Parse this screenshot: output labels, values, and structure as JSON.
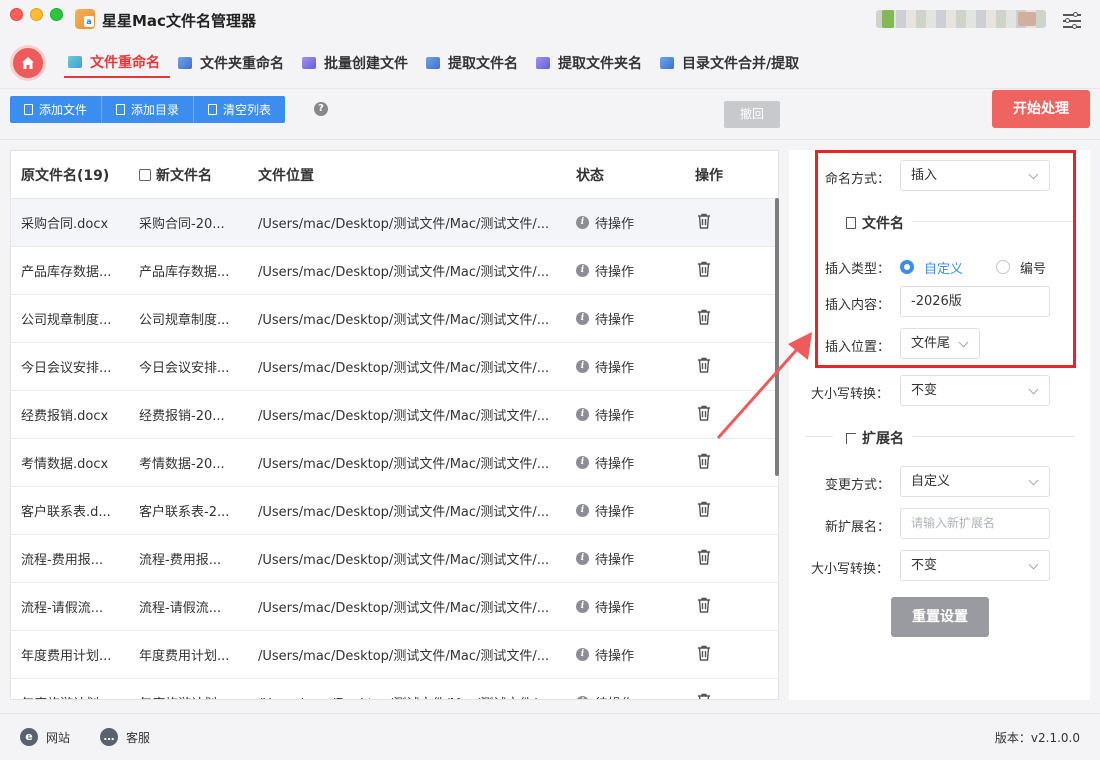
{
  "app": {
    "title": "星星Mac文件名管理器",
    "logo_letter": "a"
  },
  "tabs": [
    {
      "label": "文件重命名",
      "active": true
    },
    {
      "label": "文件夹重命名"
    },
    {
      "label": "批量创建文件"
    },
    {
      "label": "提取文件名"
    },
    {
      "label": "提取文件夹名"
    },
    {
      "label": "目录文件合并/提取"
    }
  ],
  "toolbar": {
    "add_file": "添加文件",
    "add_dir": "添加目录",
    "clear_list": "清空列表",
    "help": "?",
    "undo": "撤回",
    "start": "开始处理"
  },
  "table": {
    "headers": {
      "orig": "原文件名(19)",
      "new": "新文件名",
      "path": "文件位置",
      "status": "状态",
      "action": "操作"
    },
    "rows": [
      {
        "orig": "采购合同.docx",
        "new": "采购合同-20...",
        "path": "/Users/mac/Desktop/测试文件/Mac/测试文件/...",
        "status": "待操作"
      },
      {
        "orig": "产品库存数据...",
        "new": "产品库存数据...",
        "path": "/Users/mac/Desktop/测试文件/Mac/测试文件/...",
        "status": "待操作"
      },
      {
        "orig": "公司规章制度...",
        "new": "公司规章制度...",
        "path": "/Users/mac/Desktop/测试文件/Mac/测试文件/...",
        "status": "待操作"
      },
      {
        "orig": "今日会议安排...",
        "new": "今日会议安排...",
        "path": "/Users/mac/Desktop/测试文件/Mac/测试文件/...",
        "status": "待操作"
      },
      {
        "orig": "经费报销.docx",
        "new": "经费报销-20...",
        "path": "/Users/mac/Desktop/测试文件/Mac/测试文件/...",
        "status": "待操作"
      },
      {
        "orig": "考情数据.docx",
        "new": "考情数据-20...",
        "path": "/Users/mac/Desktop/测试文件/Mac/测试文件/...",
        "status": "待操作"
      },
      {
        "orig": "客户联系表.d...",
        "new": "客户联系表-2...",
        "path": "/Users/mac/Desktop/测试文件/Mac/测试文件/...",
        "status": "待操作"
      },
      {
        "orig": "流程-费用报...",
        "new": "流程-费用报...",
        "path": "/Users/mac/Desktop/测试文件/Mac/测试文件/...",
        "status": "待操作"
      },
      {
        "orig": "流程-请假流...",
        "new": "流程-请假流...",
        "path": "/Users/mac/Desktop/测试文件/Mac/测试文件/...",
        "status": "待操作"
      },
      {
        "orig": "年度费用计划...",
        "new": "年度费用计划...",
        "path": "/Users/mac/Desktop/测试文件/Mac/测试文件/...",
        "status": "待操作"
      },
      {
        "orig": "年度旅游计划...",
        "new": "年度旅游计划...",
        "path": "/Users/mac/Desktop/测试文件/Mac/测试文件/...",
        "status": "待操作"
      }
    ]
  },
  "settings": {
    "naming_mode_label": "命名方式：",
    "naming_mode_value": "插入",
    "filename_section": "文件名",
    "insert_type_label": "插入类型：",
    "insert_type_custom": "自定义",
    "insert_type_number": "编号",
    "insert_content_label": "插入内容：",
    "insert_content_value": "-2026版",
    "insert_pos_label": "插入位置：",
    "insert_pos_value": "文件尾",
    "case_label": "大小写转换：",
    "case_value": "不变",
    "ext_section": "扩展名",
    "change_mode_label": "变更方式：",
    "change_mode_value": "自定义",
    "new_ext_label": "新扩展名：",
    "new_ext_placeholder": "请输入新扩展名",
    "ext_case_label": "大小写转换：",
    "ext_case_value": "不变",
    "reset": "重置设置"
  },
  "footer": {
    "website": "网站",
    "support": "客服",
    "version": "版本：v2.1.0.0"
  },
  "colors": {
    "accent_red": "#e4393c",
    "primary_blue": "#3b8ef0",
    "start_red": "#ef6461",
    "highlight_box": "#e5252a"
  }
}
